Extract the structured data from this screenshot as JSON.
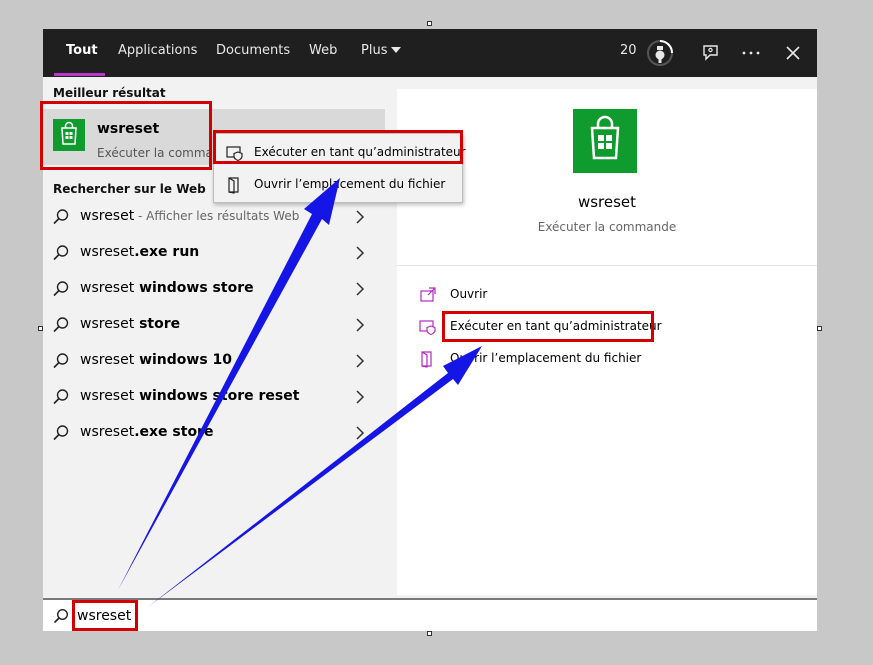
{
  "tabs": [
    {
      "label": "Tout",
      "active": true
    },
    {
      "label": "Applications"
    },
    {
      "label": "Documents"
    },
    {
      "label": "Web"
    },
    {
      "label": "Plus"
    }
  ],
  "topbar": {
    "points": "20",
    "icons": [
      "rewards-medal-icon",
      "feedback-icon",
      "more-options-icon",
      "close-icon"
    ]
  },
  "best_match": {
    "section_label": "Meilleur résultat",
    "title": "wsreset",
    "subtitle": "Exécuter la commande",
    "icon": "microsoft-store-icon",
    "icon_color": "#109b2e"
  },
  "web": {
    "section_label": "Rechercher sur le Web",
    "items": [
      {
        "prefix": "wsreset",
        "suffix": "",
        "hint": " - Afficher les résultats Web"
      },
      {
        "prefix": "wsreset",
        "suffix": ".exe run",
        "hint": ""
      },
      {
        "prefix": "wsreset",
        "suffix": " windows store",
        "hint": ""
      },
      {
        "prefix": "wsreset",
        "suffix": " store",
        "hint": ""
      },
      {
        "prefix": "wsreset",
        "suffix": " windows 10",
        "hint": ""
      },
      {
        "prefix": "wsreset",
        "suffix": " windows store reset",
        "hint": ""
      },
      {
        "prefix": "wsreset",
        "suffix": ".exe store",
        "hint": ""
      }
    ]
  },
  "context_menu": [
    {
      "label": "Exécuter en tant qu’administrateur",
      "icon": "admin-shield-icon"
    },
    {
      "label": "Ouvrir l’emplacement du fichier",
      "icon": "file-location-icon"
    }
  ],
  "details": {
    "title": "wsreset",
    "subtitle": "Exécuter la commande",
    "actions": [
      {
        "label": "Ouvrir",
        "icon": "open-icon"
      },
      {
        "label": "Exécuter en tant qu’administrateur",
        "icon": "admin-shield-icon"
      },
      {
        "label": "Ouvrir l’emplacement du fichier",
        "icon": "file-location-icon"
      }
    ]
  },
  "search": {
    "value": "wsreset"
  },
  "colors": {
    "accent": "#b936c8",
    "annotation_box": "#d40000",
    "annotation_arrow": "#1515e6",
    "topbar": "#1f1f1f"
  }
}
